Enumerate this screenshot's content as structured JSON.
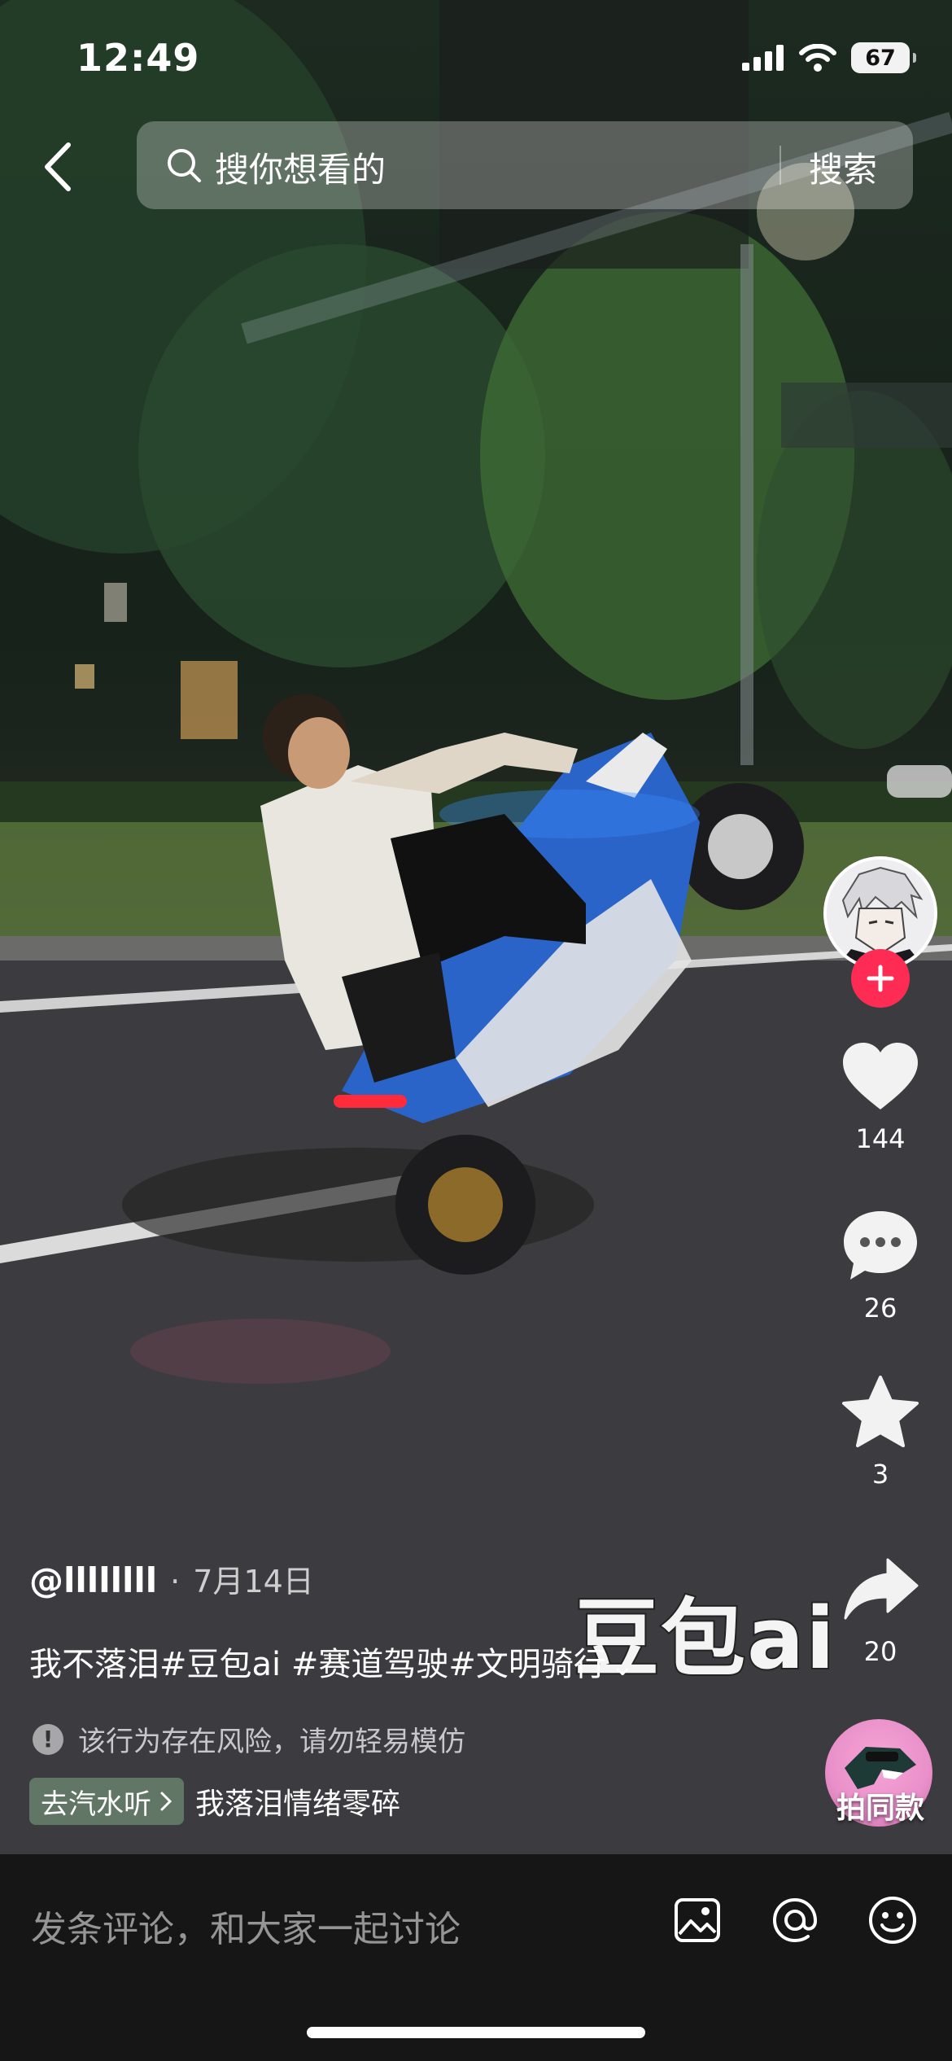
{
  "status_bar": {
    "time": "12:49",
    "battery": "67"
  },
  "search": {
    "placeholder": "搜你想看的",
    "submit_label": "搜索"
  },
  "actions": {
    "likes": "144",
    "comments": "26",
    "favorites": "3",
    "shares": "20"
  },
  "same_style": {
    "label": "拍同款"
  },
  "post": {
    "author": "@llllllll",
    "separator": "·",
    "date": "7月14日",
    "description": "我不落泪#豆包ai #赛道驾驶#文明骑行",
    "more_arrow": "⌄",
    "watermark": "豆包ai",
    "risk_notice": "该行为存在风险，请勿轻易模仿",
    "music_chip": "去汽水听",
    "music_title": "我落泪情绪零碎"
  },
  "comment_bar": {
    "placeholder": "发条评论，和大家一起讨论"
  },
  "colors": {
    "follow": "#fe2c55",
    "bottom_bar": "#161616"
  },
  "icons": [
    "back-arrow-icon",
    "search-icon",
    "heart-icon",
    "comment-icon",
    "star-icon",
    "share-icon",
    "image-icon",
    "at-icon",
    "emoji-icon",
    "signal-icon",
    "wifi-icon"
  ]
}
